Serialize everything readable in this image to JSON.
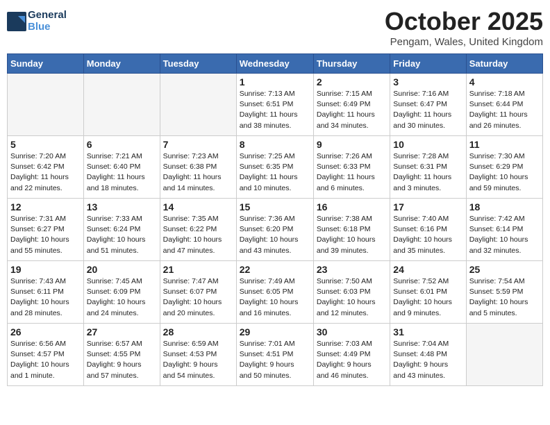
{
  "header": {
    "logo_line1": "General",
    "logo_line2": "Blue",
    "month": "October 2025",
    "location": "Pengam, Wales, United Kingdom"
  },
  "weekdays": [
    "Sunday",
    "Monday",
    "Tuesday",
    "Wednesday",
    "Thursday",
    "Friday",
    "Saturday"
  ],
  "weeks": [
    [
      {
        "day": "",
        "text": ""
      },
      {
        "day": "",
        "text": ""
      },
      {
        "day": "",
        "text": ""
      },
      {
        "day": "1",
        "text": "Sunrise: 7:13 AM\nSunset: 6:51 PM\nDaylight: 11 hours\nand 38 minutes."
      },
      {
        "day": "2",
        "text": "Sunrise: 7:15 AM\nSunset: 6:49 PM\nDaylight: 11 hours\nand 34 minutes."
      },
      {
        "day": "3",
        "text": "Sunrise: 7:16 AM\nSunset: 6:47 PM\nDaylight: 11 hours\nand 30 minutes."
      },
      {
        "day": "4",
        "text": "Sunrise: 7:18 AM\nSunset: 6:44 PM\nDaylight: 11 hours\nand 26 minutes."
      }
    ],
    [
      {
        "day": "5",
        "text": "Sunrise: 7:20 AM\nSunset: 6:42 PM\nDaylight: 11 hours\nand 22 minutes."
      },
      {
        "day": "6",
        "text": "Sunrise: 7:21 AM\nSunset: 6:40 PM\nDaylight: 11 hours\nand 18 minutes."
      },
      {
        "day": "7",
        "text": "Sunrise: 7:23 AM\nSunset: 6:38 PM\nDaylight: 11 hours\nand 14 minutes."
      },
      {
        "day": "8",
        "text": "Sunrise: 7:25 AM\nSunset: 6:35 PM\nDaylight: 11 hours\nand 10 minutes."
      },
      {
        "day": "9",
        "text": "Sunrise: 7:26 AM\nSunset: 6:33 PM\nDaylight: 11 hours\nand 6 minutes."
      },
      {
        "day": "10",
        "text": "Sunrise: 7:28 AM\nSunset: 6:31 PM\nDaylight: 11 hours\nand 3 minutes."
      },
      {
        "day": "11",
        "text": "Sunrise: 7:30 AM\nSunset: 6:29 PM\nDaylight: 10 hours\nand 59 minutes."
      }
    ],
    [
      {
        "day": "12",
        "text": "Sunrise: 7:31 AM\nSunset: 6:27 PM\nDaylight: 10 hours\nand 55 minutes."
      },
      {
        "day": "13",
        "text": "Sunrise: 7:33 AM\nSunset: 6:24 PM\nDaylight: 10 hours\nand 51 minutes."
      },
      {
        "day": "14",
        "text": "Sunrise: 7:35 AM\nSunset: 6:22 PM\nDaylight: 10 hours\nand 47 minutes."
      },
      {
        "day": "15",
        "text": "Sunrise: 7:36 AM\nSunset: 6:20 PM\nDaylight: 10 hours\nand 43 minutes."
      },
      {
        "day": "16",
        "text": "Sunrise: 7:38 AM\nSunset: 6:18 PM\nDaylight: 10 hours\nand 39 minutes."
      },
      {
        "day": "17",
        "text": "Sunrise: 7:40 AM\nSunset: 6:16 PM\nDaylight: 10 hours\nand 35 minutes."
      },
      {
        "day": "18",
        "text": "Sunrise: 7:42 AM\nSunset: 6:14 PM\nDaylight: 10 hours\nand 32 minutes."
      }
    ],
    [
      {
        "day": "19",
        "text": "Sunrise: 7:43 AM\nSunset: 6:11 PM\nDaylight: 10 hours\nand 28 minutes."
      },
      {
        "day": "20",
        "text": "Sunrise: 7:45 AM\nSunset: 6:09 PM\nDaylight: 10 hours\nand 24 minutes."
      },
      {
        "day": "21",
        "text": "Sunrise: 7:47 AM\nSunset: 6:07 PM\nDaylight: 10 hours\nand 20 minutes."
      },
      {
        "day": "22",
        "text": "Sunrise: 7:49 AM\nSunset: 6:05 PM\nDaylight: 10 hours\nand 16 minutes."
      },
      {
        "day": "23",
        "text": "Sunrise: 7:50 AM\nSunset: 6:03 PM\nDaylight: 10 hours\nand 12 minutes."
      },
      {
        "day": "24",
        "text": "Sunrise: 7:52 AM\nSunset: 6:01 PM\nDaylight: 10 hours\nand 9 minutes."
      },
      {
        "day": "25",
        "text": "Sunrise: 7:54 AM\nSunset: 5:59 PM\nDaylight: 10 hours\nand 5 minutes."
      }
    ],
    [
      {
        "day": "26",
        "text": "Sunrise: 6:56 AM\nSunset: 4:57 PM\nDaylight: 10 hours\nand 1 minute."
      },
      {
        "day": "27",
        "text": "Sunrise: 6:57 AM\nSunset: 4:55 PM\nDaylight: 9 hours\nand 57 minutes."
      },
      {
        "day": "28",
        "text": "Sunrise: 6:59 AM\nSunset: 4:53 PM\nDaylight: 9 hours\nand 54 minutes."
      },
      {
        "day": "29",
        "text": "Sunrise: 7:01 AM\nSunset: 4:51 PM\nDaylight: 9 hours\nand 50 minutes."
      },
      {
        "day": "30",
        "text": "Sunrise: 7:03 AM\nSunset: 4:49 PM\nDaylight: 9 hours\nand 46 minutes."
      },
      {
        "day": "31",
        "text": "Sunrise: 7:04 AM\nSunset: 4:48 PM\nDaylight: 9 hours\nand 43 minutes."
      },
      {
        "day": "",
        "text": ""
      }
    ]
  ]
}
